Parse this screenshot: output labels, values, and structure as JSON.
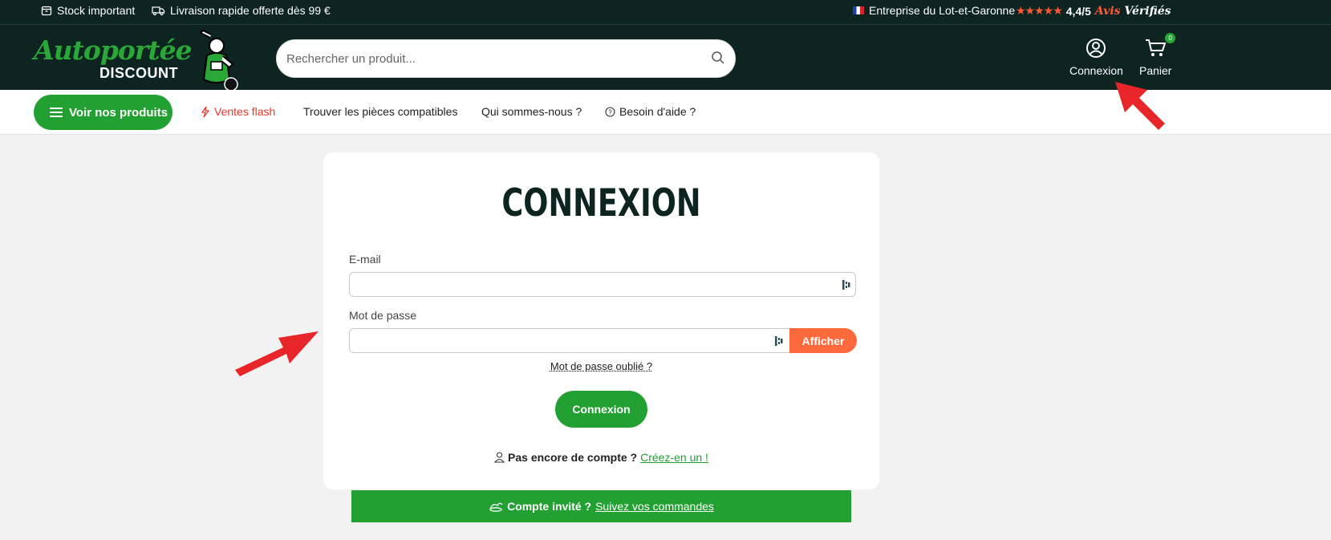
{
  "topbar": {
    "stock": "Stock important",
    "delivery": "Livraison rapide offerte dès 99 €",
    "company": "Entreprise du Lot-et-Garonne",
    "rating": "4,4/5",
    "stars": "★★★★★",
    "avis_word1": "Avis",
    "avis_word2": "Vérifiés"
  },
  "header": {
    "logo_line1": "Autoportée",
    "logo_line2": "DISCOUNT",
    "search_placeholder": "Rechercher un produit...",
    "login_label": "Connexion",
    "cart_label": "Panier",
    "cart_count": "0"
  },
  "nav": {
    "products_button": "Voir nos produits",
    "links": [
      "Ventes flash",
      "Trouver les pièces compatibles",
      "Qui sommes-nous ?",
      "Besoin d'aide ?"
    ]
  },
  "login": {
    "title": "CONNEXION",
    "email_label": "E-mail",
    "email_value": "",
    "password_label": "Mot de passe",
    "password_value": "",
    "show_button": "Afficher",
    "forgot_link": "Mot de passe oublié ?",
    "submit_button": "Connexion",
    "no_account_text": "Pas encore de compte ?",
    "create_link": "Créez-en un !"
  },
  "guest": {
    "text": "Compte invité ?",
    "link": "Suivez vos commandes"
  },
  "colors": {
    "dark": "#0d2420",
    "green": "#23a032",
    "orange": "#ff6a3d",
    "flash_red": "#e23b2e",
    "arrow_red": "#e8262a"
  }
}
